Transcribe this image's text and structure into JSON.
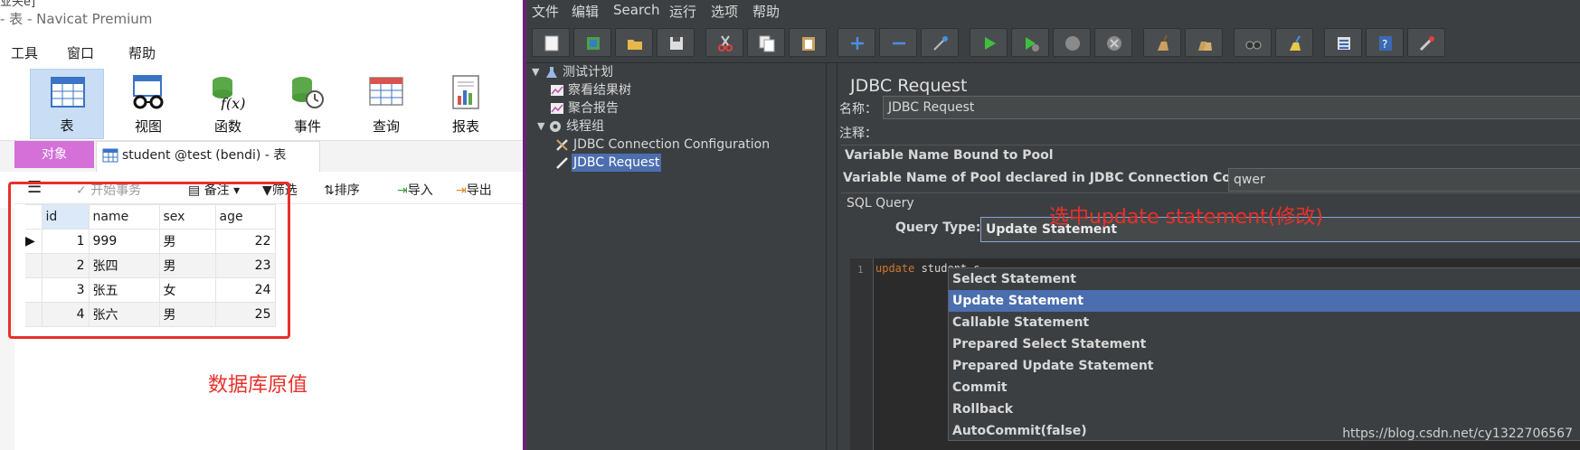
{
  "navicat": {
    "crumb": "业失ề]",
    "window_title": "- 表 - Navicat Premium",
    "menu": [
      "工具",
      "窗口",
      "帮助"
    ],
    "ribbon": [
      {
        "label": "表",
        "icon": "table-icon",
        "active": true
      },
      {
        "label": "视图",
        "icon": "view-glasses-icon",
        "active": false
      },
      {
        "label": "函数",
        "icon": "function-icon",
        "active": false
      },
      {
        "label": "事件",
        "icon": "event-clock-icon",
        "active": false
      },
      {
        "label": "查询",
        "icon": "query-icon",
        "active": false
      },
      {
        "label": "报表",
        "icon": "report-icon",
        "active": false
      }
    ],
    "tabs": {
      "objects": "对象",
      "student": "student @test (bendi) - 表"
    },
    "toolbar": {
      "begin_tx": "开始事务",
      "note": "备注",
      "filter": "筛选",
      "sort": "排序",
      "import": "导入",
      "export": "导出"
    },
    "grid": {
      "columns": [
        "id",
        "name",
        "sex",
        "age"
      ],
      "rows": [
        {
          "id": "1",
          "name": "999",
          "sex": "男",
          "age": "22"
        },
        {
          "id": "2",
          "name": "张四",
          "sex": "男",
          "age": "23"
        },
        {
          "id": "3",
          "name": "张五",
          "sex": "女",
          "age": "24"
        },
        {
          "id": "4",
          "name": "张六",
          "sex": "男",
          "age": "25"
        }
      ]
    },
    "annotation": "数据库原值",
    "annotation_color": "#e8302a"
  },
  "jmeter": {
    "menu": [
      "文件",
      "编辑",
      "Search",
      "运行",
      "选项",
      "帮助"
    ],
    "tree": {
      "plan": "测试计划",
      "results_tree": "察看结果树",
      "aggregate": "聚合报告",
      "thread_group": "线程组",
      "jdbc_config": "JDBC Connection Configuration",
      "jdbc_request": "JDBC Request"
    },
    "panel": {
      "title": "JDBC Request",
      "name_label": "名称：",
      "name_value": "JDBC Request",
      "comment_label": "注释：",
      "pool_section": "Variable Name Bound to Pool",
      "pool_label": "Variable Name of Pool declared in JDBC Connection Configuration:",
      "pool_value": "qwer",
      "sql_section": "SQL Query",
      "query_type_label": "Query Type:",
      "query_type_value": "Update Statement",
      "line_number": "1",
      "code_keyword": "update",
      "code_rest": " student s"
    },
    "dropdown_options": [
      "Select Statement",
      "Update Statement",
      "Callable Statement",
      "Prepared Select Statement",
      "Prepared Update Statement",
      "Commit",
      "Rollback",
      "AutoCommit(false)"
    ],
    "dropdown_selected": "Update Statement",
    "annotation": "选中update statement(修改)",
    "watermark": "https://blog.csdn.net/cy1322706567",
    "colors": {
      "background": "#3c3f41",
      "selection": "#4b6eaf",
      "annotation": "#e8302a"
    }
  }
}
